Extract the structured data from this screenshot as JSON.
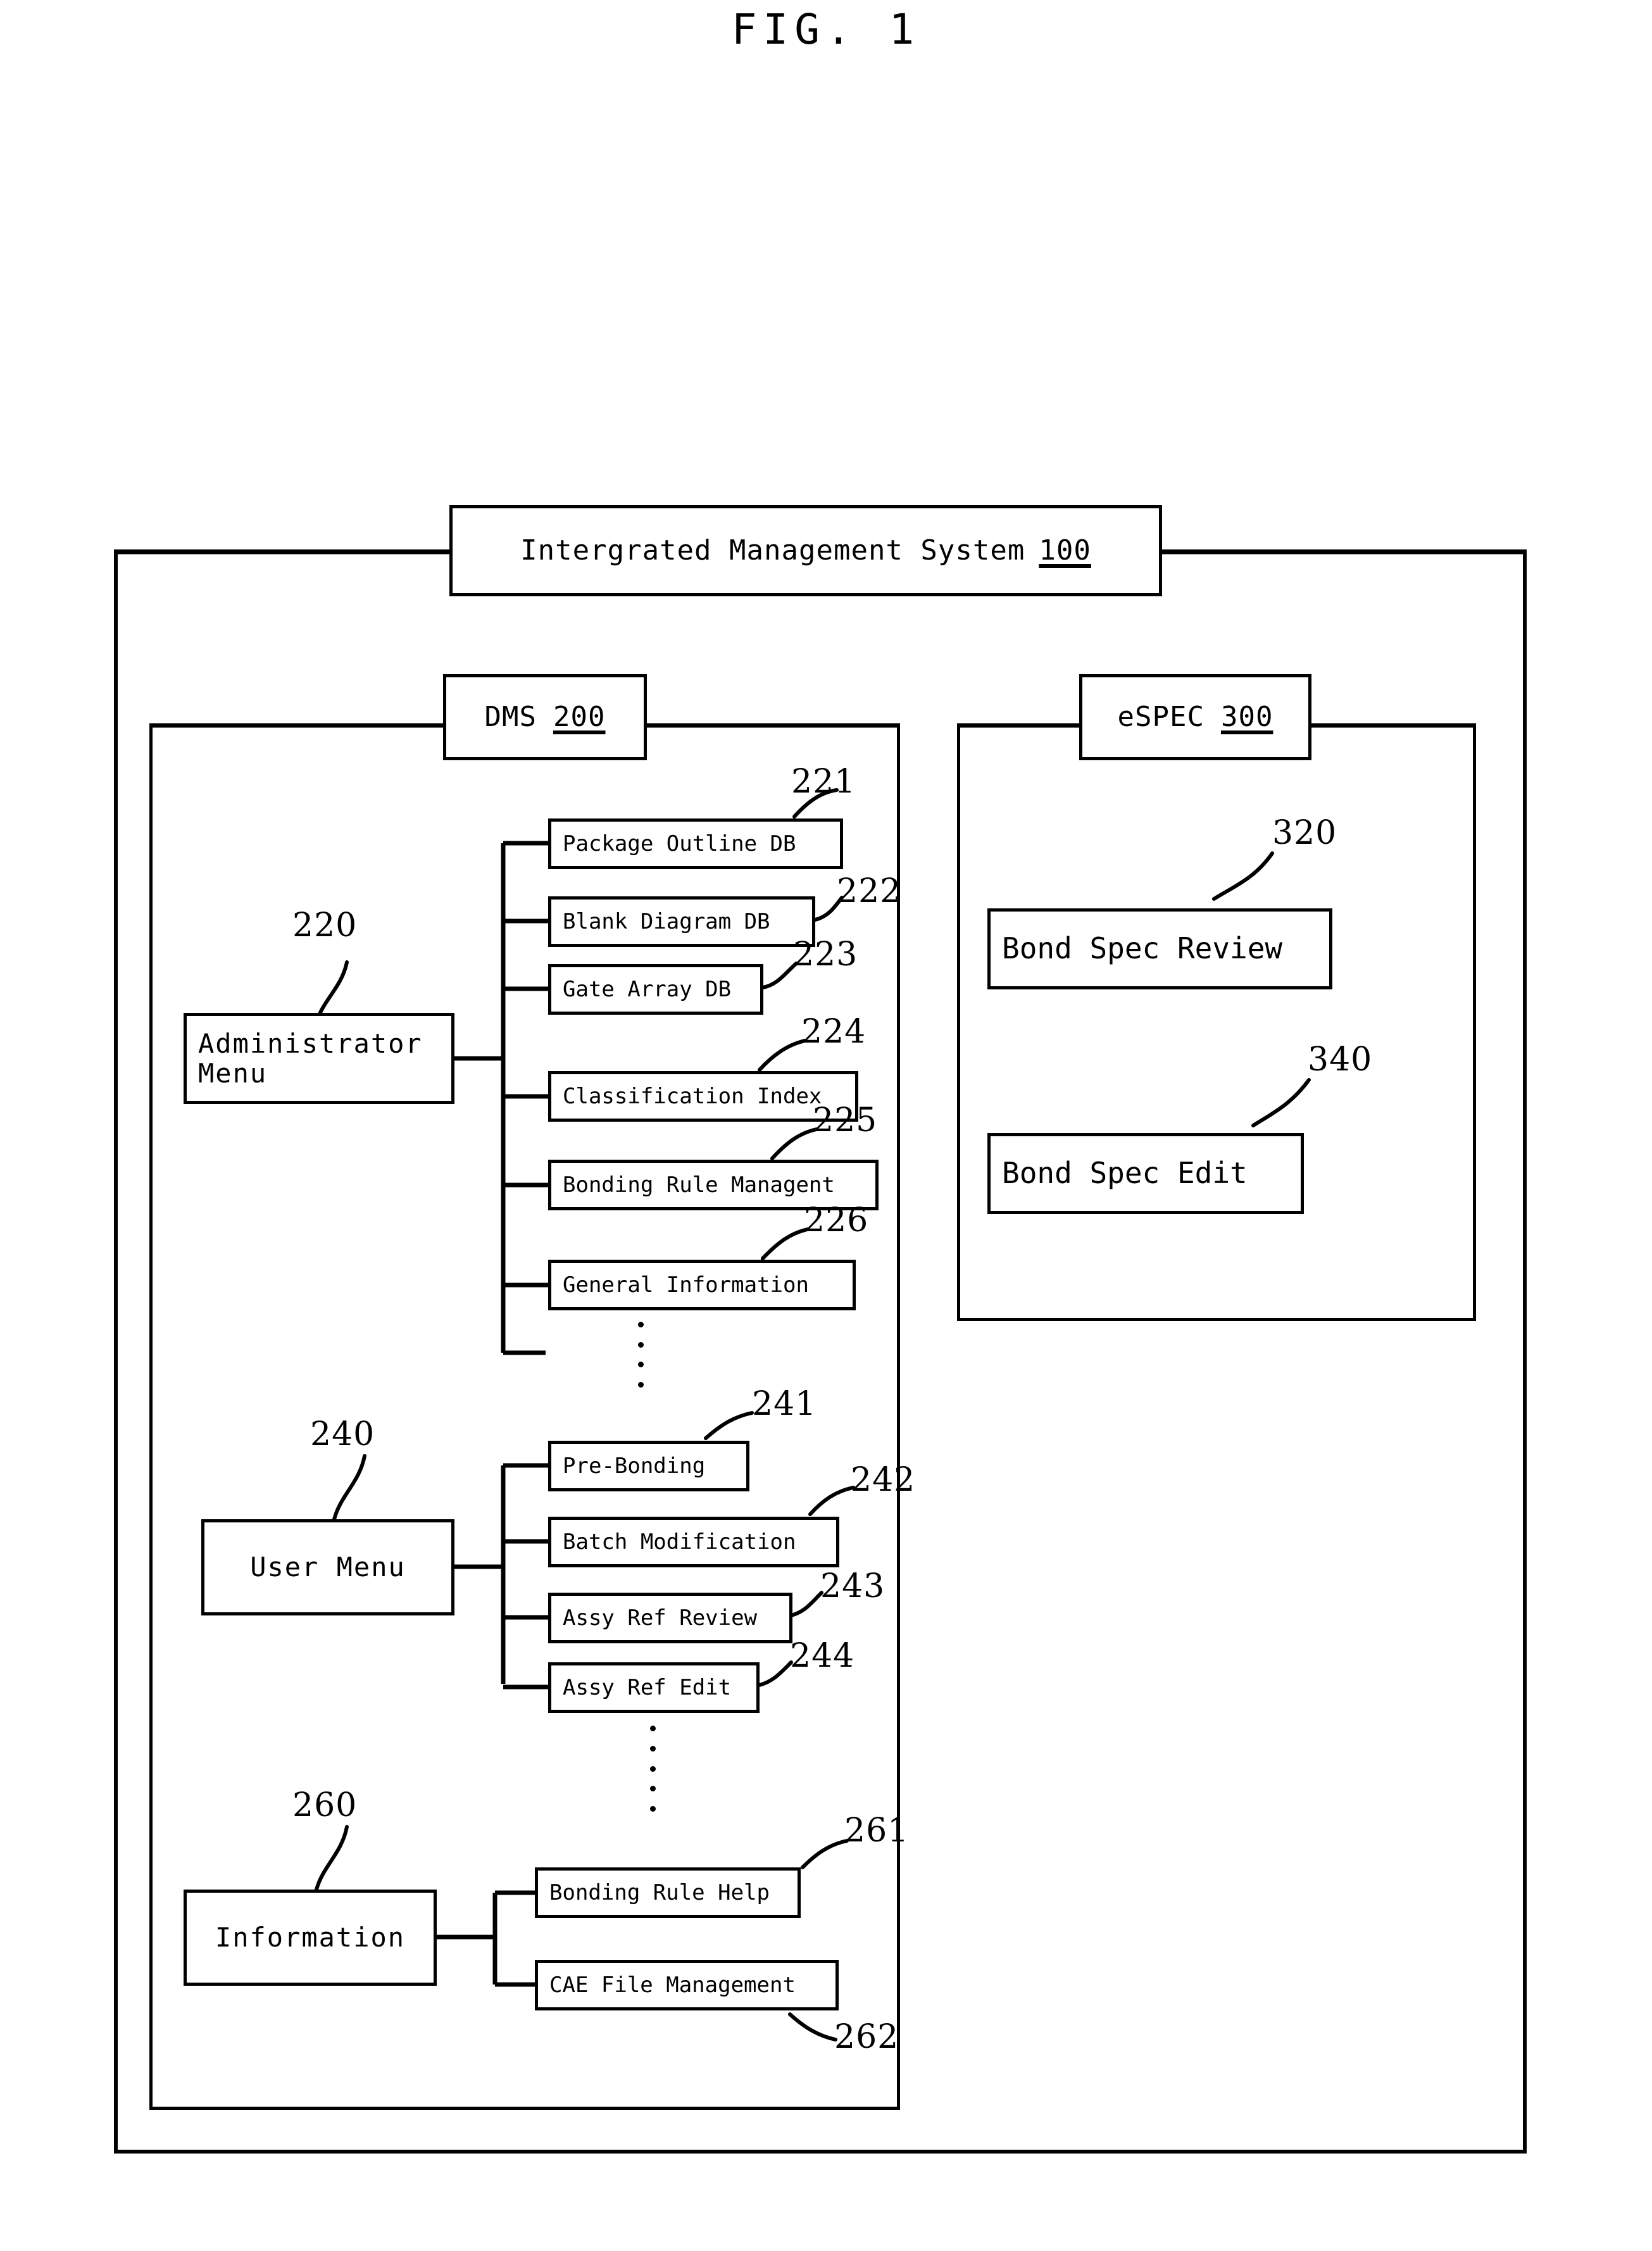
{
  "figure": {
    "title": "FIG. 1"
  },
  "system": {
    "label": "Intergrated Management System",
    "ref": "100"
  },
  "dms": {
    "label": "DMS",
    "ref": "200",
    "groups": [
      {
        "name": "administrator",
        "label": "Administrator\nMenu",
        "label_line1": "Administrator",
        "label_line2": "Menu",
        "ref": "220",
        "items": [
          {
            "label": "Package Outline DB",
            "ref": "221"
          },
          {
            "label": "Blank Diagram DB",
            "ref": "222"
          },
          {
            "label": "Gate Array DB",
            "ref": "223"
          },
          {
            "label": "Classification Index",
            "ref": "224"
          },
          {
            "label": "Bonding Rule Managent",
            "ref": "225"
          },
          {
            "label": "General Information",
            "ref": "226"
          }
        ],
        "has_ellipsis": true
      },
      {
        "name": "user",
        "label": "User Menu",
        "ref": "240",
        "items": [
          {
            "label": "Pre-Bonding",
            "ref": "241"
          },
          {
            "label": "Batch Modification",
            "ref": "242"
          },
          {
            "label": "Assy Ref Review",
            "ref": "243"
          },
          {
            "label": "Assy Ref Edit",
            "ref": "244"
          }
        ],
        "has_ellipsis": true
      },
      {
        "name": "information",
        "label": "Information",
        "ref": "260",
        "items": [
          {
            "label": "Bonding Rule Help",
            "ref": "261"
          },
          {
            "label": "CAE File Management",
            "ref": "262"
          }
        ],
        "has_ellipsis": false
      }
    ]
  },
  "espec": {
    "label": "eSPEC",
    "ref": "300",
    "items": [
      {
        "label": "Bond Spec Review",
        "ref": "320"
      },
      {
        "label": "Bond Spec Edit",
        "ref": "340"
      }
    ]
  }
}
